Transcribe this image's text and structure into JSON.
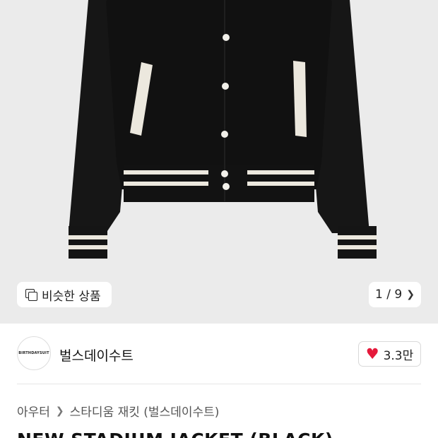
{
  "gallery": {
    "similar_label": "비슷한 상품",
    "counter": "1 / 9"
  },
  "brand": {
    "logo_text": "BIRTHDAYSUIT",
    "name": "벌스데이수트",
    "likes": "3.3만"
  },
  "breadcrumb": {
    "category": "아우터",
    "subcategory": "스타디움 재킷 (벌스데이수트)"
  },
  "product": {
    "title": "NEW STADIUM JACKET (BLACK)"
  },
  "icons": {
    "similar": "copy-square-icon",
    "next": "chevron-right-icon",
    "like": "heart-icon"
  },
  "colors": {
    "heart": "#e5193b",
    "hero_bg": "#ebebeb",
    "jacket": "#141414",
    "stripe": "#ece8de"
  }
}
